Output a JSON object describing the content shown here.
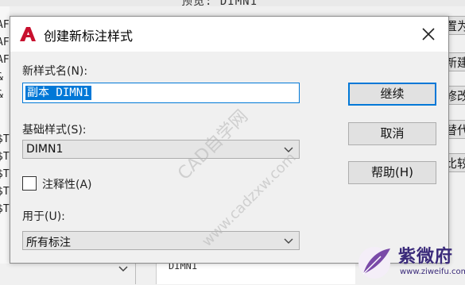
{
  "background": {
    "preview_label": "预览: DIMN1",
    "left_fragments": [
      "AF",
      "AF",
      "AF",
      "&",
      "&",
      "$T",
      "$T",
      "$T",
      "$T",
      "$T"
    ],
    "right_buttons": [
      "置为",
      "新建",
      "修改",
      "替代",
      "比较"
    ],
    "bottom_text": "DIMN1"
  },
  "dialog": {
    "title": "创建新标注样式",
    "new_style_name_label": "新样式名(N):",
    "new_style_name_value": "副本 DIMN1",
    "base_style_label": "基础样式(S):",
    "base_style_value": "DIMN1",
    "annotative_label": "注释性(A)",
    "annotative_checked": false,
    "use_for_label": "用于(U):",
    "use_for_value": "所有标注",
    "buttons": {
      "continue": "继续",
      "cancel": "取消",
      "help": "帮助(H)"
    }
  },
  "watermarks": {
    "cad_label": "CAD自学网",
    "cad_url": "www.cadzxw.com",
    "brand_name": "紫微府",
    "brand_url": "www.ziweifu.com"
  },
  "colors": {
    "accent": "#0078d7",
    "autocad_red": "#c8102e",
    "brand_purple": "#3a2a7a"
  }
}
